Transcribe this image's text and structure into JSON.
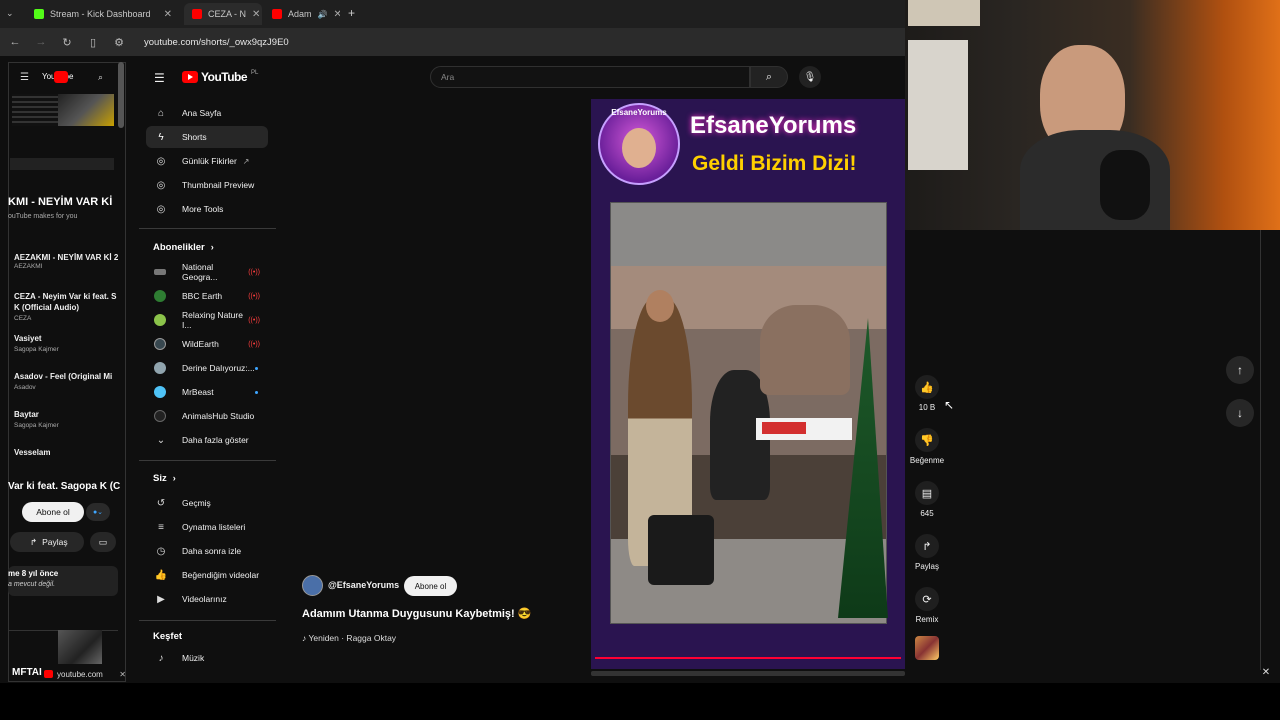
{
  "tabs": [
    {
      "label": "Stream - Kick Dashboard",
      "favicon_color": "#53fc18"
    },
    {
      "label": "CEZA - N",
      "favicon_color": "#ff0000"
    },
    {
      "label": "Adam",
      "favicon_color": "#ff0000"
    }
  ],
  "new_tab_label": "+",
  "address": {
    "url": "youtube.com/shorts/_owx9qzJ9E0"
  },
  "side_panel": {
    "header_app": "YouTube",
    "video_title": "KMI - NEYİM VAR Kİ",
    "video_sub": "ouTube makes for you",
    "items": [
      {
        "title": "AEZAKMI - NEYİM VAR Kİ 2",
        "channel": "AEZAKMI"
      },
      {
        "title": "CEZA - Neyim Var ki feat. S",
        "title2": "K (Official Audio)",
        "channel": "CEZA"
      },
      {
        "title": "Vasiyet",
        "channel": "Sagopa Kajmer"
      },
      {
        "title": "Asadov - Feel (Original Mi",
        "channel": "Asadov"
      },
      {
        "title": "Baytar",
        "channel": "Sagopa Kajmer"
      },
      {
        "title": "Vesselam",
        "channel": ""
      }
    ],
    "now_title": "Var ki feat. Sagopa K (C",
    "subscribe": "Abone ol",
    "share": "Paylaş",
    "meta_line1": "me 8 yıl önce",
    "meta_line2": "a mevcut değil.",
    "bottom_tab": "youtube.com",
    "bottom_thumb_text": "MFTAI"
  },
  "nav": {
    "logo": "YouTube",
    "logo_region": "PL",
    "main": [
      {
        "label": "Ana Sayfa",
        "icon": "home-icon"
      },
      {
        "label": "Shorts",
        "icon": "shorts-icon"
      },
      {
        "label": "Günlük Fikirler",
        "icon": "sparkle-icon"
      },
      {
        "label": "Thumbnail Preview",
        "icon": "sparkle-icon"
      },
      {
        "label": "More Tools",
        "icon": "sparkle-icon"
      }
    ],
    "subscriptions_header": "Abonelikler",
    "subscriptions": [
      {
        "label": "National Geogra...",
        "color": "#777777",
        "badge": "live"
      },
      {
        "label": "BBC Earth",
        "color": "#2e7d32",
        "badge": "live"
      },
      {
        "label": "Relaxing Nature I...",
        "color": "#8bc34a",
        "badge": "live"
      },
      {
        "label": "WildEarth",
        "color": "#37474f",
        "badge": "live"
      },
      {
        "label": "Derine Dalıyoruz:...",
        "color": "#90a4ae",
        "badge": "new"
      },
      {
        "label": "MrBeast",
        "color": "#4fc3f7",
        "badge": "new"
      },
      {
        "label": "AnimalsHub Studio",
        "color": "#222222",
        "badge": "none"
      }
    ],
    "show_more": "Daha fazla göster",
    "you_header": "Siz",
    "you": [
      {
        "label": "Geçmiş",
        "icon": "history-icon"
      },
      {
        "label": "Oynatma listeleri",
        "icon": "playlist-icon"
      },
      {
        "label": "Daha sonra izle",
        "icon": "clock-icon"
      },
      {
        "label": "Beğendiğim videolar",
        "icon": "like-icon"
      },
      {
        "label": "Videolarınız",
        "icon": "video-icon"
      }
    ],
    "explore_header": "Keşfet",
    "explore": [
      {
        "label": "Müzik",
        "icon": "music-icon"
      }
    ],
    "live_badge": "((•))"
  },
  "search": {
    "placeholder": "Ara"
  },
  "short": {
    "banner_badge": "EfsaneYorums",
    "banner_title": "EfsaneYorums",
    "banner_sub": "Geldi Bizim Dizi!",
    "channel": "@EfsaneYorums",
    "subscribe": "Abone ol",
    "title": "Adamım Utanma Duygusunu Kaybetmiş! 😎",
    "music": "Yeniden · Ragga Oktay",
    "progress_fraction": 1.0
  },
  "actions": {
    "likes": "10 B",
    "dislike": "Beğenme",
    "comments": "645",
    "share": "Paylaş",
    "remix": "Remix"
  }
}
